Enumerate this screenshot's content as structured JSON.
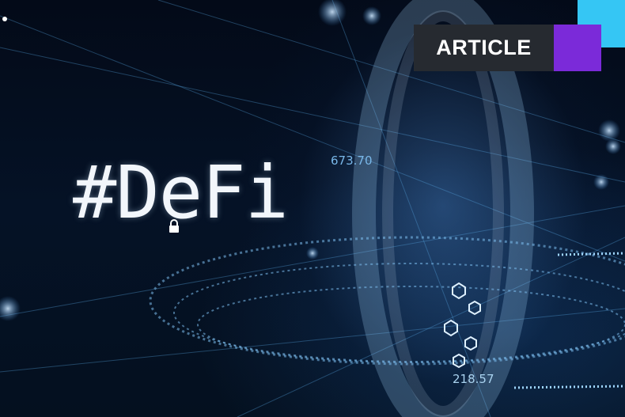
{
  "badge": {
    "label": "ARTICLE"
  },
  "headline": {
    "text": "#DeFi"
  },
  "numbers": {
    "top": "673.70",
    "bottom": "218.57"
  },
  "colors": {
    "badge_bg": "#262a30",
    "accent_purple": "#7b2ad9",
    "accent_cyan": "#35c6f4"
  }
}
